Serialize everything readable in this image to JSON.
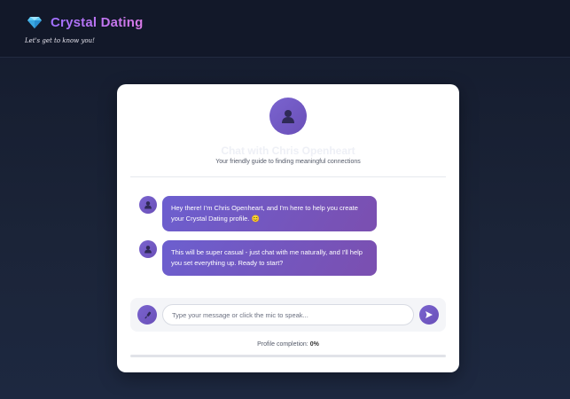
{
  "header": {
    "brand": "Crystal Dating",
    "tagline": "Let's get to know you!",
    "logo_icon": "gem-icon"
  },
  "chat": {
    "title": "Chat with Chris Openheart",
    "subtitle": "Your friendly guide to finding meaningful connections",
    "messages": [
      {
        "text": "Hey there! I'm Chris Openheart, and I'm here to help you create your Crystal Dating profile. 😊"
      },
      {
        "text": "This will be super casual - just chat with me naturally, and I'll help you set everything up. Ready to start?"
      }
    ]
  },
  "input": {
    "placeholder": "Type your message or click the mic to speak...",
    "value": "",
    "mic_icon": "microphone-icon",
    "send_icon": "send-icon"
  },
  "progress": {
    "label": "Profile completion:",
    "value_text": "0%",
    "value": 0
  },
  "colors": {
    "accent": "#7a64cf",
    "bubble": "#6c5fcf",
    "header_bg": "#121829"
  }
}
